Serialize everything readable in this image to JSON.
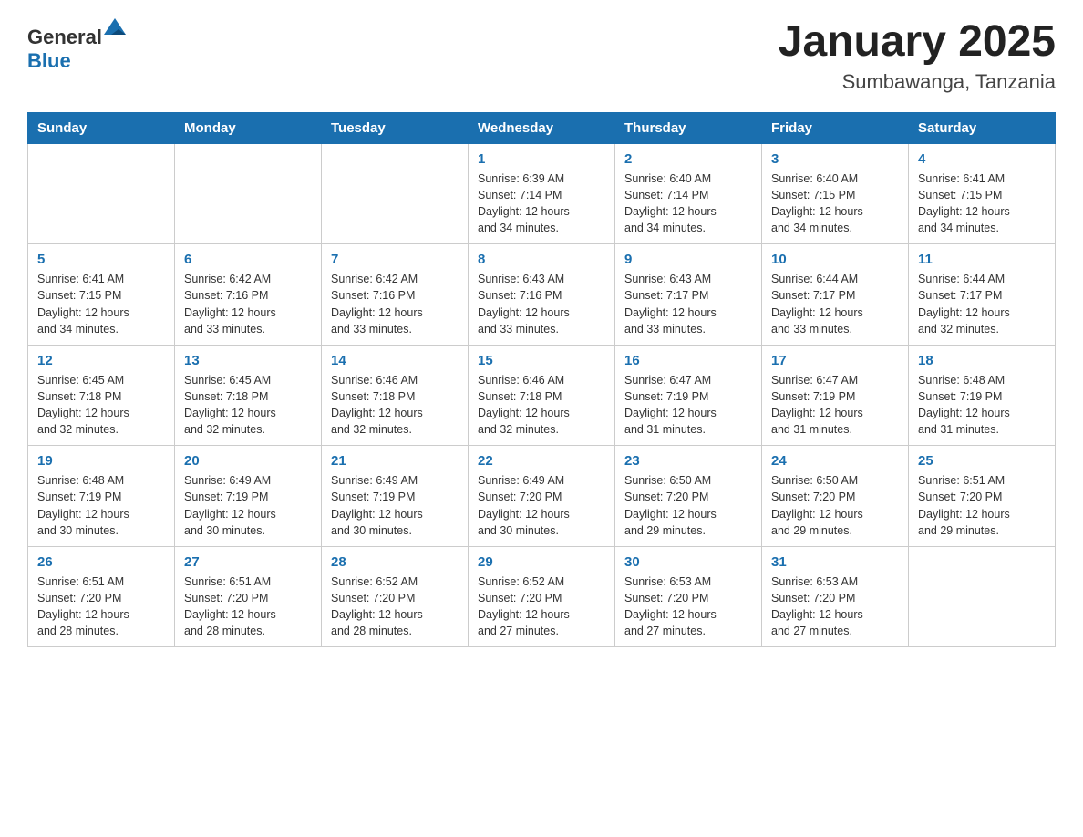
{
  "header": {
    "logo_general": "General",
    "logo_blue": "Blue",
    "month_title": "January 2025",
    "location": "Sumbawanga, Tanzania"
  },
  "days_of_week": [
    "Sunday",
    "Monday",
    "Tuesday",
    "Wednesday",
    "Thursday",
    "Friday",
    "Saturday"
  ],
  "weeks": [
    [
      {
        "day": "",
        "info": ""
      },
      {
        "day": "",
        "info": ""
      },
      {
        "day": "",
        "info": ""
      },
      {
        "day": "1",
        "info": "Sunrise: 6:39 AM\nSunset: 7:14 PM\nDaylight: 12 hours\nand 34 minutes."
      },
      {
        "day": "2",
        "info": "Sunrise: 6:40 AM\nSunset: 7:14 PM\nDaylight: 12 hours\nand 34 minutes."
      },
      {
        "day": "3",
        "info": "Sunrise: 6:40 AM\nSunset: 7:15 PM\nDaylight: 12 hours\nand 34 minutes."
      },
      {
        "day": "4",
        "info": "Sunrise: 6:41 AM\nSunset: 7:15 PM\nDaylight: 12 hours\nand 34 minutes."
      }
    ],
    [
      {
        "day": "5",
        "info": "Sunrise: 6:41 AM\nSunset: 7:15 PM\nDaylight: 12 hours\nand 34 minutes."
      },
      {
        "day": "6",
        "info": "Sunrise: 6:42 AM\nSunset: 7:16 PM\nDaylight: 12 hours\nand 33 minutes."
      },
      {
        "day": "7",
        "info": "Sunrise: 6:42 AM\nSunset: 7:16 PM\nDaylight: 12 hours\nand 33 minutes."
      },
      {
        "day": "8",
        "info": "Sunrise: 6:43 AM\nSunset: 7:16 PM\nDaylight: 12 hours\nand 33 minutes."
      },
      {
        "day": "9",
        "info": "Sunrise: 6:43 AM\nSunset: 7:17 PM\nDaylight: 12 hours\nand 33 minutes."
      },
      {
        "day": "10",
        "info": "Sunrise: 6:44 AM\nSunset: 7:17 PM\nDaylight: 12 hours\nand 33 minutes."
      },
      {
        "day": "11",
        "info": "Sunrise: 6:44 AM\nSunset: 7:17 PM\nDaylight: 12 hours\nand 32 minutes."
      }
    ],
    [
      {
        "day": "12",
        "info": "Sunrise: 6:45 AM\nSunset: 7:18 PM\nDaylight: 12 hours\nand 32 minutes."
      },
      {
        "day": "13",
        "info": "Sunrise: 6:45 AM\nSunset: 7:18 PM\nDaylight: 12 hours\nand 32 minutes."
      },
      {
        "day": "14",
        "info": "Sunrise: 6:46 AM\nSunset: 7:18 PM\nDaylight: 12 hours\nand 32 minutes."
      },
      {
        "day": "15",
        "info": "Sunrise: 6:46 AM\nSunset: 7:18 PM\nDaylight: 12 hours\nand 32 minutes."
      },
      {
        "day": "16",
        "info": "Sunrise: 6:47 AM\nSunset: 7:19 PM\nDaylight: 12 hours\nand 31 minutes."
      },
      {
        "day": "17",
        "info": "Sunrise: 6:47 AM\nSunset: 7:19 PM\nDaylight: 12 hours\nand 31 minutes."
      },
      {
        "day": "18",
        "info": "Sunrise: 6:48 AM\nSunset: 7:19 PM\nDaylight: 12 hours\nand 31 minutes."
      }
    ],
    [
      {
        "day": "19",
        "info": "Sunrise: 6:48 AM\nSunset: 7:19 PM\nDaylight: 12 hours\nand 30 minutes."
      },
      {
        "day": "20",
        "info": "Sunrise: 6:49 AM\nSunset: 7:19 PM\nDaylight: 12 hours\nand 30 minutes."
      },
      {
        "day": "21",
        "info": "Sunrise: 6:49 AM\nSunset: 7:19 PM\nDaylight: 12 hours\nand 30 minutes."
      },
      {
        "day": "22",
        "info": "Sunrise: 6:49 AM\nSunset: 7:20 PM\nDaylight: 12 hours\nand 30 minutes."
      },
      {
        "day": "23",
        "info": "Sunrise: 6:50 AM\nSunset: 7:20 PM\nDaylight: 12 hours\nand 29 minutes."
      },
      {
        "day": "24",
        "info": "Sunrise: 6:50 AM\nSunset: 7:20 PM\nDaylight: 12 hours\nand 29 minutes."
      },
      {
        "day": "25",
        "info": "Sunrise: 6:51 AM\nSunset: 7:20 PM\nDaylight: 12 hours\nand 29 minutes."
      }
    ],
    [
      {
        "day": "26",
        "info": "Sunrise: 6:51 AM\nSunset: 7:20 PM\nDaylight: 12 hours\nand 28 minutes."
      },
      {
        "day": "27",
        "info": "Sunrise: 6:51 AM\nSunset: 7:20 PM\nDaylight: 12 hours\nand 28 minutes."
      },
      {
        "day": "28",
        "info": "Sunrise: 6:52 AM\nSunset: 7:20 PM\nDaylight: 12 hours\nand 28 minutes."
      },
      {
        "day": "29",
        "info": "Sunrise: 6:52 AM\nSunset: 7:20 PM\nDaylight: 12 hours\nand 27 minutes."
      },
      {
        "day": "30",
        "info": "Sunrise: 6:53 AM\nSunset: 7:20 PM\nDaylight: 12 hours\nand 27 minutes."
      },
      {
        "day": "31",
        "info": "Sunrise: 6:53 AM\nSunset: 7:20 PM\nDaylight: 12 hours\nand 27 minutes."
      },
      {
        "day": "",
        "info": ""
      }
    ]
  ]
}
